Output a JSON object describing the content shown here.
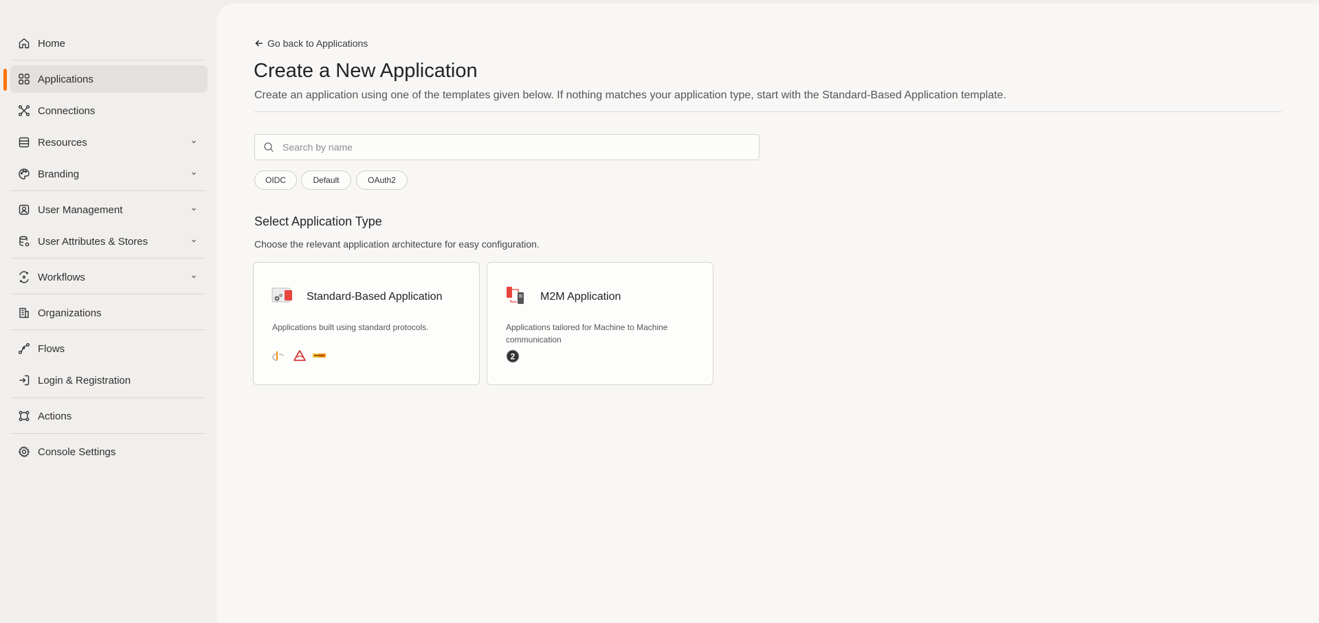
{
  "sidebar": {
    "items": [
      {
        "label": "Home",
        "icon": "home-icon"
      },
      {
        "label": "Applications",
        "icon": "grid-icon",
        "active": true
      },
      {
        "label": "Connections",
        "icon": "connections-icon"
      },
      {
        "label": "Resources",
        "icon": "resources-icon",
        "expandable": true
      },
      {
        "label": "Branding",
        "icon": "palette-icon",
        "expandable": true
      },
      {
        "label": "User Management",
        "icon": "user-icon",
        "expandable": true
      },
      {
        "label": "User Attributes & Stores",
        "icon": "database-icon",
        "expandable": true
      },
      {
        "label": "Workflows",
        "icon": "workflow-icon",
        "expandable": true
      },
      {
        "label": "Organizations",
        "icon": "building-icon"
      },
      {
        "label": "Flows",
        "icon": "flows-icon"
      },
      {
        "label": "Login & Registration",
        "icon": "login-icon"
      },
      {
        "label": "Actions",
        "icon": "actions-icon"
      },
      {
        "label": "Console Settings",
        "icon": "gear-icon"
      }
    ],
    "accent_color": "#ff7300"
  },
  "main": {
    "back_link": "Go back to Applications",
    "title": "Create a New Application",
    "description": "Create an application using one of the templates given below. If nothing matches your application type, start with the Standard-Based Application template.",
    "search": {
      "placeholder": "Search by name",
      "value": ""
    },
    "filters": [
      "OIDC",
      "Default",
      "OAuth2"
    ],
    "section": {
      "title": "Select Application Type",
      "description": "Choose the relevant application architecture for easy configuration."
    },
    "cards": [
      {
        "title": "Standard-Based Application",
        "description": "Applications built using standard protocols.",
        "icon": "standard-app-icon",
        "logos": [
          "openid-logo",
          "saml-logo",
          "ws-fed-logo"
        ]
      },
      {
        "title": "M2M Application",
        "description": "Applications tailored for Machine to Machine communication",
        "icon": "m2m-app-icon",
        "logos": [
          "oauth2-logo"
        ]
      }
    ]
  }
}
